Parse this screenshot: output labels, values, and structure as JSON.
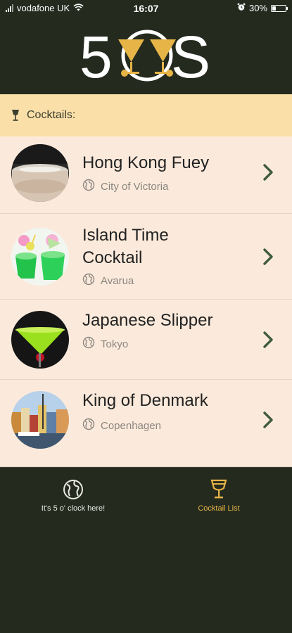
{
  "status_bar": {
    "carrier": "vodafone UK",
    "time": "16:07",
    "battery": "30%",
    "battery_level": 0.3
  },
  "header": {
    "logo_text_left": "5",
    "logo_text_right": "S",
    "logo_name": "50S-logo"
  },
  "section": {
    "title": "Cocktails:",
    "icon": "cocktail-glass-icon"
  },
  "cocktails": [
    {
      "name": "Hong Kong Fuey",
      "location": "City of Victoria"
    },
    {
      "name": "Island Time Cocktail",
      "location": "Avarua"
    },
    {
      "name": "Japanese Slipper",
      "location": "Tokyo"
    },
    {
      "name": "King of Denmark",
      "location": "Copenhagen"
    }
  ],
  "tabs": [
    {
      "label": "It's 5 o' clock here!",
      "icon": "globe-icon",
      "active": false
    },
    {
      "label": "Cocktail List",
      "icon": "cocktail-glass-icon",
      "active": true
    }
  ],
  "colors": {
    "dark_green": "#242a1e",
    "header_band": "#fbdfa8",
    "list_bg": "#fbeadb",
    "accent_gold": "#e7b547",
    "chevron_green": "#3f5a3f"
  }
}
